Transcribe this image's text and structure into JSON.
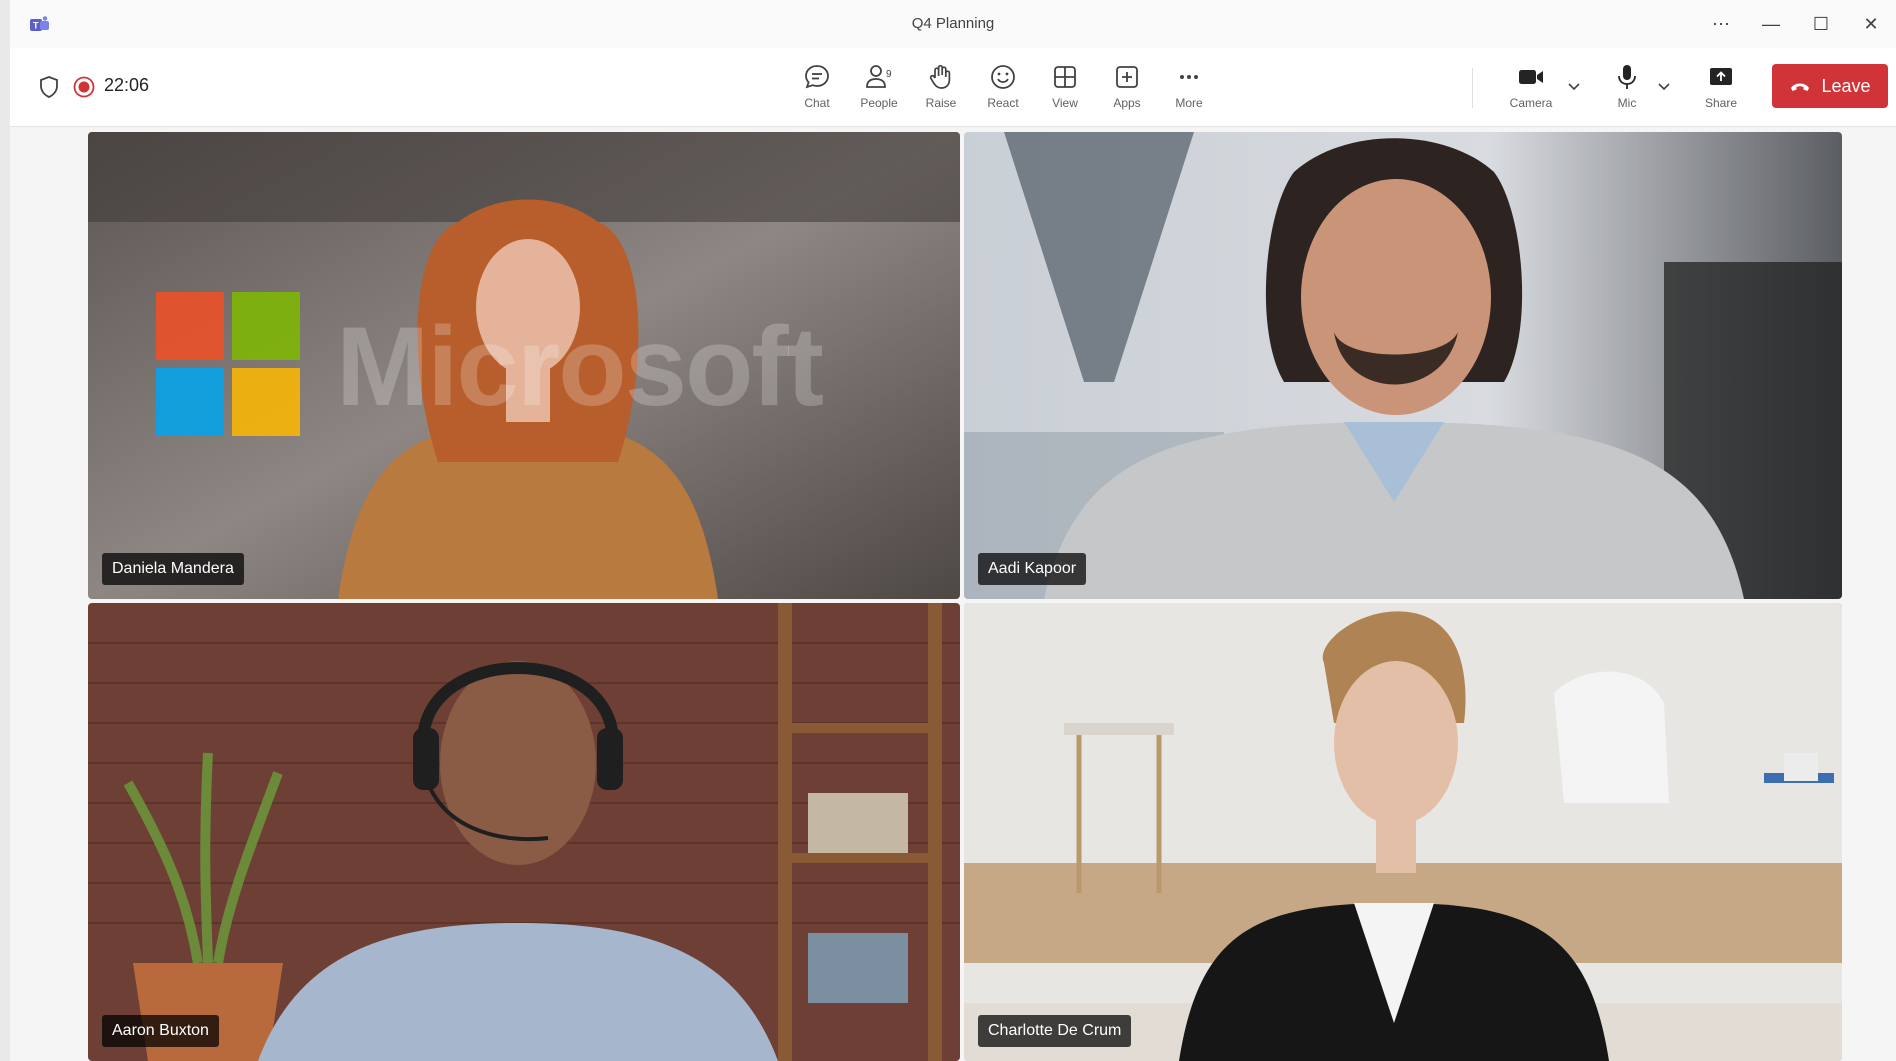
{
  "window": {
    "title": "Q4 Planning",
    "controls": {
      "more": "⋯",
      "minimize": "—",
      "maximize": "☐",
      "close": "✕"
    }
  },
  "status": {
    "timer": "22:06",
    "recording": true,
    "accent": "#d13438"
  },
  "toolbar": {
    "chat": "Chat",
    "people": "People",
    "people_count": "9",
    "raise": "Raise",
    "react": "React",
    "view": "View",
    "apps": "Apps",
    "more": "More",
    "camera": "Camera",
    "mic": "Mic",
    "share": "Share",
    "leave": "Leave"
  },
  "participants": [
    {
      "name": "Daniela Mandera",
      "background_text": "Microsoft"
    },
    {
      "name": "Aadi Kapoor"
    },
    {
      "name": "Aaron Buxton"
    },
    {
      "name": "Charlotte De Crum",
      "active_speaker": true
    }
  ],
  "colors": {
    "leave_red": "#d13438",
    "active_outline": "#7f85f5",
    "ms_red": "#f25022",
    "ms_green": "#7fba00",
    "ms_blue": "#00a4ef",
    "ms_yellow": "#ffb900"
  }
}
